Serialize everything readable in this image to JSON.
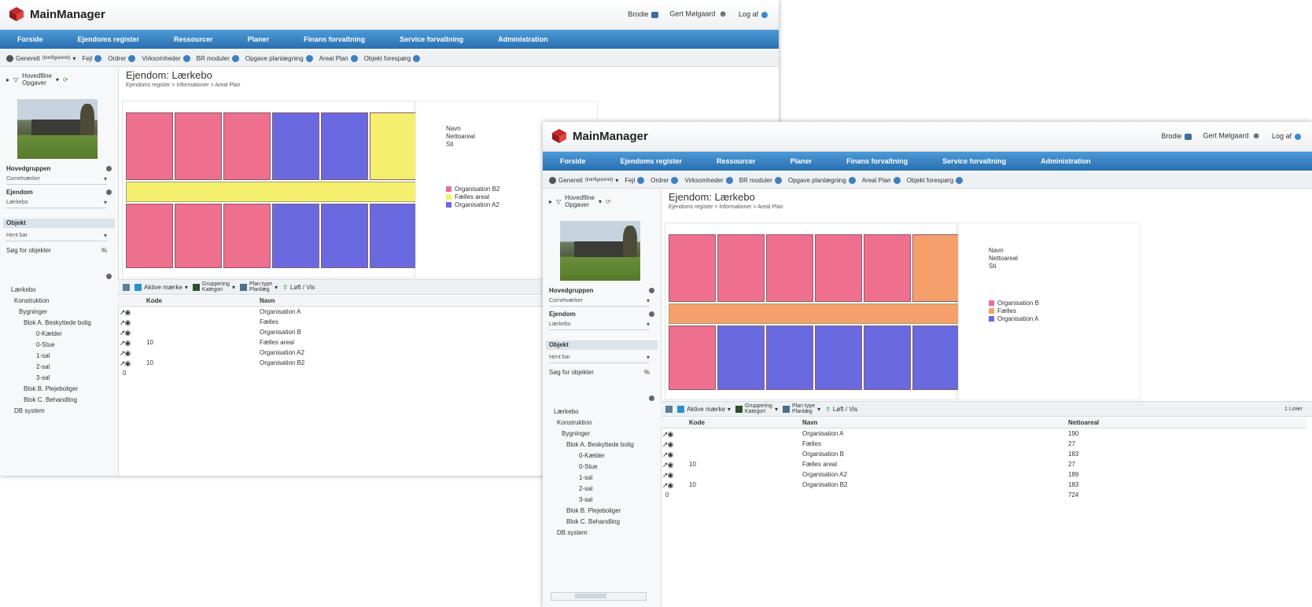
{
  "app": {
    "title": "MainManager"
  },
  "header": {
    "user1": "Brodie",
    "user2": "Gert Mølgaard",
    "logout": "Log af"
  },
  "nav": [
    "Forside",
    "Ejendoms register",
    "Ressourcer",
    "Planer",
    "Finans forvaltning",
    "Service forvaltning",
    "Administration"
  ],
  "toolbar": {
    "start": "Generelt",
    "start_sub": "(konfigureret)",
    "items": [
      "Fejl",
      "Ordrer",
      "Virksomheder",
      "BR moduler",
      "Opgave planlægning",
      "Areal Plan",
      "Objekt forespørg"
    ]
  },
  "sidebar": {
    "filter_label": "Hovedfilne",
    "filter_sub": "Opgaver",
    "group_label": "Hovedgruppen",
    "group_value": "Cornetværker",
    "property_label": "Ejendom",
    "property_value": "Lærkebo",
    "object_section": "Objekt",
    "object_value": "Hent bar",
    "search_label": "Søg for objekter",
    "search_suffix": "%",
    "tree_back": [
      "Lærkebo",
      "Konstruktion",
      "Bygninger",
      "Blok A. Beskyttede bolig",
      "0-Kælder",
      "0-Stue",
      "1-sal",
      "2-sal",
      "3-sal",
      "Blok B. Plejeboliger",
      "Blok C. Behandling",
      "DB system"
    ],
    "tree_front": [
      "Lærkebo",
      "Konstruktion",
      "Bygninger",
      "Blok A. Beskyttede bolig",
      "0-Kælder",
      "0-Stue",
      "1-sal",
      "2-sal",
      "3-sal",
      "Blok B. Plejeboliger",
      "Blok C. Behandling",
      "DB system"
    ]
  },
  "main": {
    "title": "Ejendom: Lærkebo",
    "breadcrumb": "Ejendoms register > Informationer > Areal Plan"
  },
  "info_back": {
    "l1": "Navn",
    "l2": "Nettoareal",
    "l3": "Sti"
  },
  "info_front": {
    "l1": "Navn",
    "l2": "Nettoareal",
    "l3": "Sti"
  },
  "legend_back": [
    {
      "label": "Organisation B2",
      "color": "#ef6f8f"
    },
    {
      "label": "Fælles areal",
      "color": "#f4f06e"
    },
    {
      "label": "Organisation A2",
      "color": "#6a6ae0"
    }
  ],
  "legend_front": [
    {
      "label": "Organisation B",
      "color": "#ef6f8f"
    },
    {
      "label": "Fælles",
      "color": "#f5a06b"
    },
    {
      "label": "Organisation A",
      "color": "#6a6ae0"
    }
  ],
  "grid_toolbar": {
    "actions": "Aktive mærke",
    "grouping": "Gruppering",
    "grouping_sub": "Kategori",
    "plan_type": "Plan type",
    "plan_type_sub": "Planlæg",
    "move": "Løft / Vis",
    "paging": "1 Linier"
  },
  "table": {
    "headers": {
      "code": "Kode",
      "name": "Navn",
      "area": "Nettoareal"
    },
    "rows": [
      {
        "code": "",
        "name": "Organisation A",
        "area": "190"
      },
      {
        "code": "",
        "name": "Fælles",
        "area": "27"
      },
      {
        "code": "",
        "name": "Organisation B",
        "area": "183"
      },
      {
        "code": "10",
        "name": "Fælles areal",
        "area": "27"
      },
      {
        "code": "",
        "name": "Organisation A2",
        "area": "189"
      },
      {
        "code": "10",
        "name": "Organisation B2",
        "area": "183"
      }
    ],
    "total_code": "0",
    "total_area": "724"
  },
  "colors": {
    "pink": "#ef6f8f",
    "yellow": "#f4f06e",
    "blue": "#6a6ae0",
    "orange": "#f5a06b",
    "nav": "#2a6fb1"
  }
}
